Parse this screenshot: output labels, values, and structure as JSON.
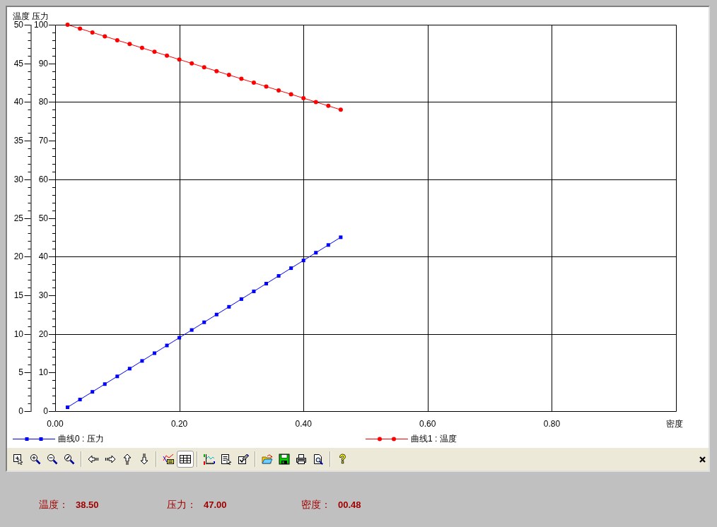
{
  "chart": {
    "chart_data": {
      "type": "line",
      "title": "温度 压力",
      "xlabel": "密度",
      "x": [
        0.02,
        0.04,
        0.06,
        0.08,
        0.1,
        0.12,
        0.14,
        0.16,
        0.18,
        0.2,
        0.22,
        0.24,
        0.26,
        0.28,
        0.3,
        0.32,
        0.34,
        0.36,
        0.38,
        0.4,
        0.42,
        0.44,
        0.46
      ],
      "series": [
        {
          "name": "曲线0 : 压力",
          "color": "#0000ff",
          "marker": "square",
          "axis": "y2",
          "values": [
            1,
            3,
            5,
            7,
            9,
            11,
            13,
            15,
            17,
            19,
            21,
            23,
            25,
            27,
            29,
            31,
            33,
            35,
            37,
            39,
            41,
            43,
            45
          ]
        },
        {
          "name": "曲线1 : 温度",
          "color": "#ff0000",
          "marker": "circle",
          "axis": "y",
          "values": [
            50,
            49.5,
            49,
            48.5,
            48,
            47.5,
            47,
            46.5,
            46,
            45.5,
            45,
            44.5,
            44,
            43.5,
            43,
            42.5,
            42,
            41.5,
            41,
            40.5,
            40,
            39.5,
            39
          ]
        }
      ],
      "xlim": [
        0,
        1
      ],
      "ylim": [
        0,
        50
      ],
      "y2lim": [
        0,
        100
      ],
      "xticks": [
        {
          "value": 0,
          "label": "0.00"
        },
        {
          "value": 0.2,
          "label": "0.20"
        },
        {
          "value": 0.4,
          "label": "0.40"
        },
        {
          "value": 0.6,
          "label": "0.60"
        },
        {
          "value": 0.8,
          "label": "0.80"
        }
      ],
      "yticks": [
        0,
        5,
        10,
        15,
        20,
        25,
        30,
        35,
        40,
        45,
        50
      ],
      "y2ticks": [
        0,
        10,
        20,
        30,
        40,
        50,
        60,
        70,
        80,
        90,
        100
      ],
      "grid": true,
      "legend": "bottom"
    }
  },
  "toolbar": {
    "groups": [
      {
        "buttons": [
          {
            "pressed": false
          },
          {
            "pressed": false
          },
          {
            "pressed": false
          },
          {
            "pressed": false
          }
        ]
      },
      {
        "buttons": [
          {
            "pressed": false
          },
          {
            "pressed": false
          },
          {
            "pressed": false
          },
          {
            "pressed": false
          }
        ]
      },
      {
        "buttons": [
          {
            "pressed": false
          },
          {
            "pressed": true
          }
        ]
      },
      {
        "buttons": [
          {
            "pressed": false
          },
          {
            "pressed": false
          },
          {
            "pressed": false
          }
        ]
      },
      {
        "buttons": [
          {
            "pressed": false
          },
          {
            "pressed": false
          },
          {
            "pressed": false
          },
          {
            "pressed": false
          }
        ]
      },
      {
        "buttons": [
          {
            "pressed": false
          }
        ]
      }
    ]
  },
  "readouts": [
    {
      "label": "温度：",
      "value": "38.50"
    },
    {
      "label": "压力：",
      "value": "47.00"
    },
    {
      "label": "密度：",
      "value": "00.48"
    }
  ]
}
